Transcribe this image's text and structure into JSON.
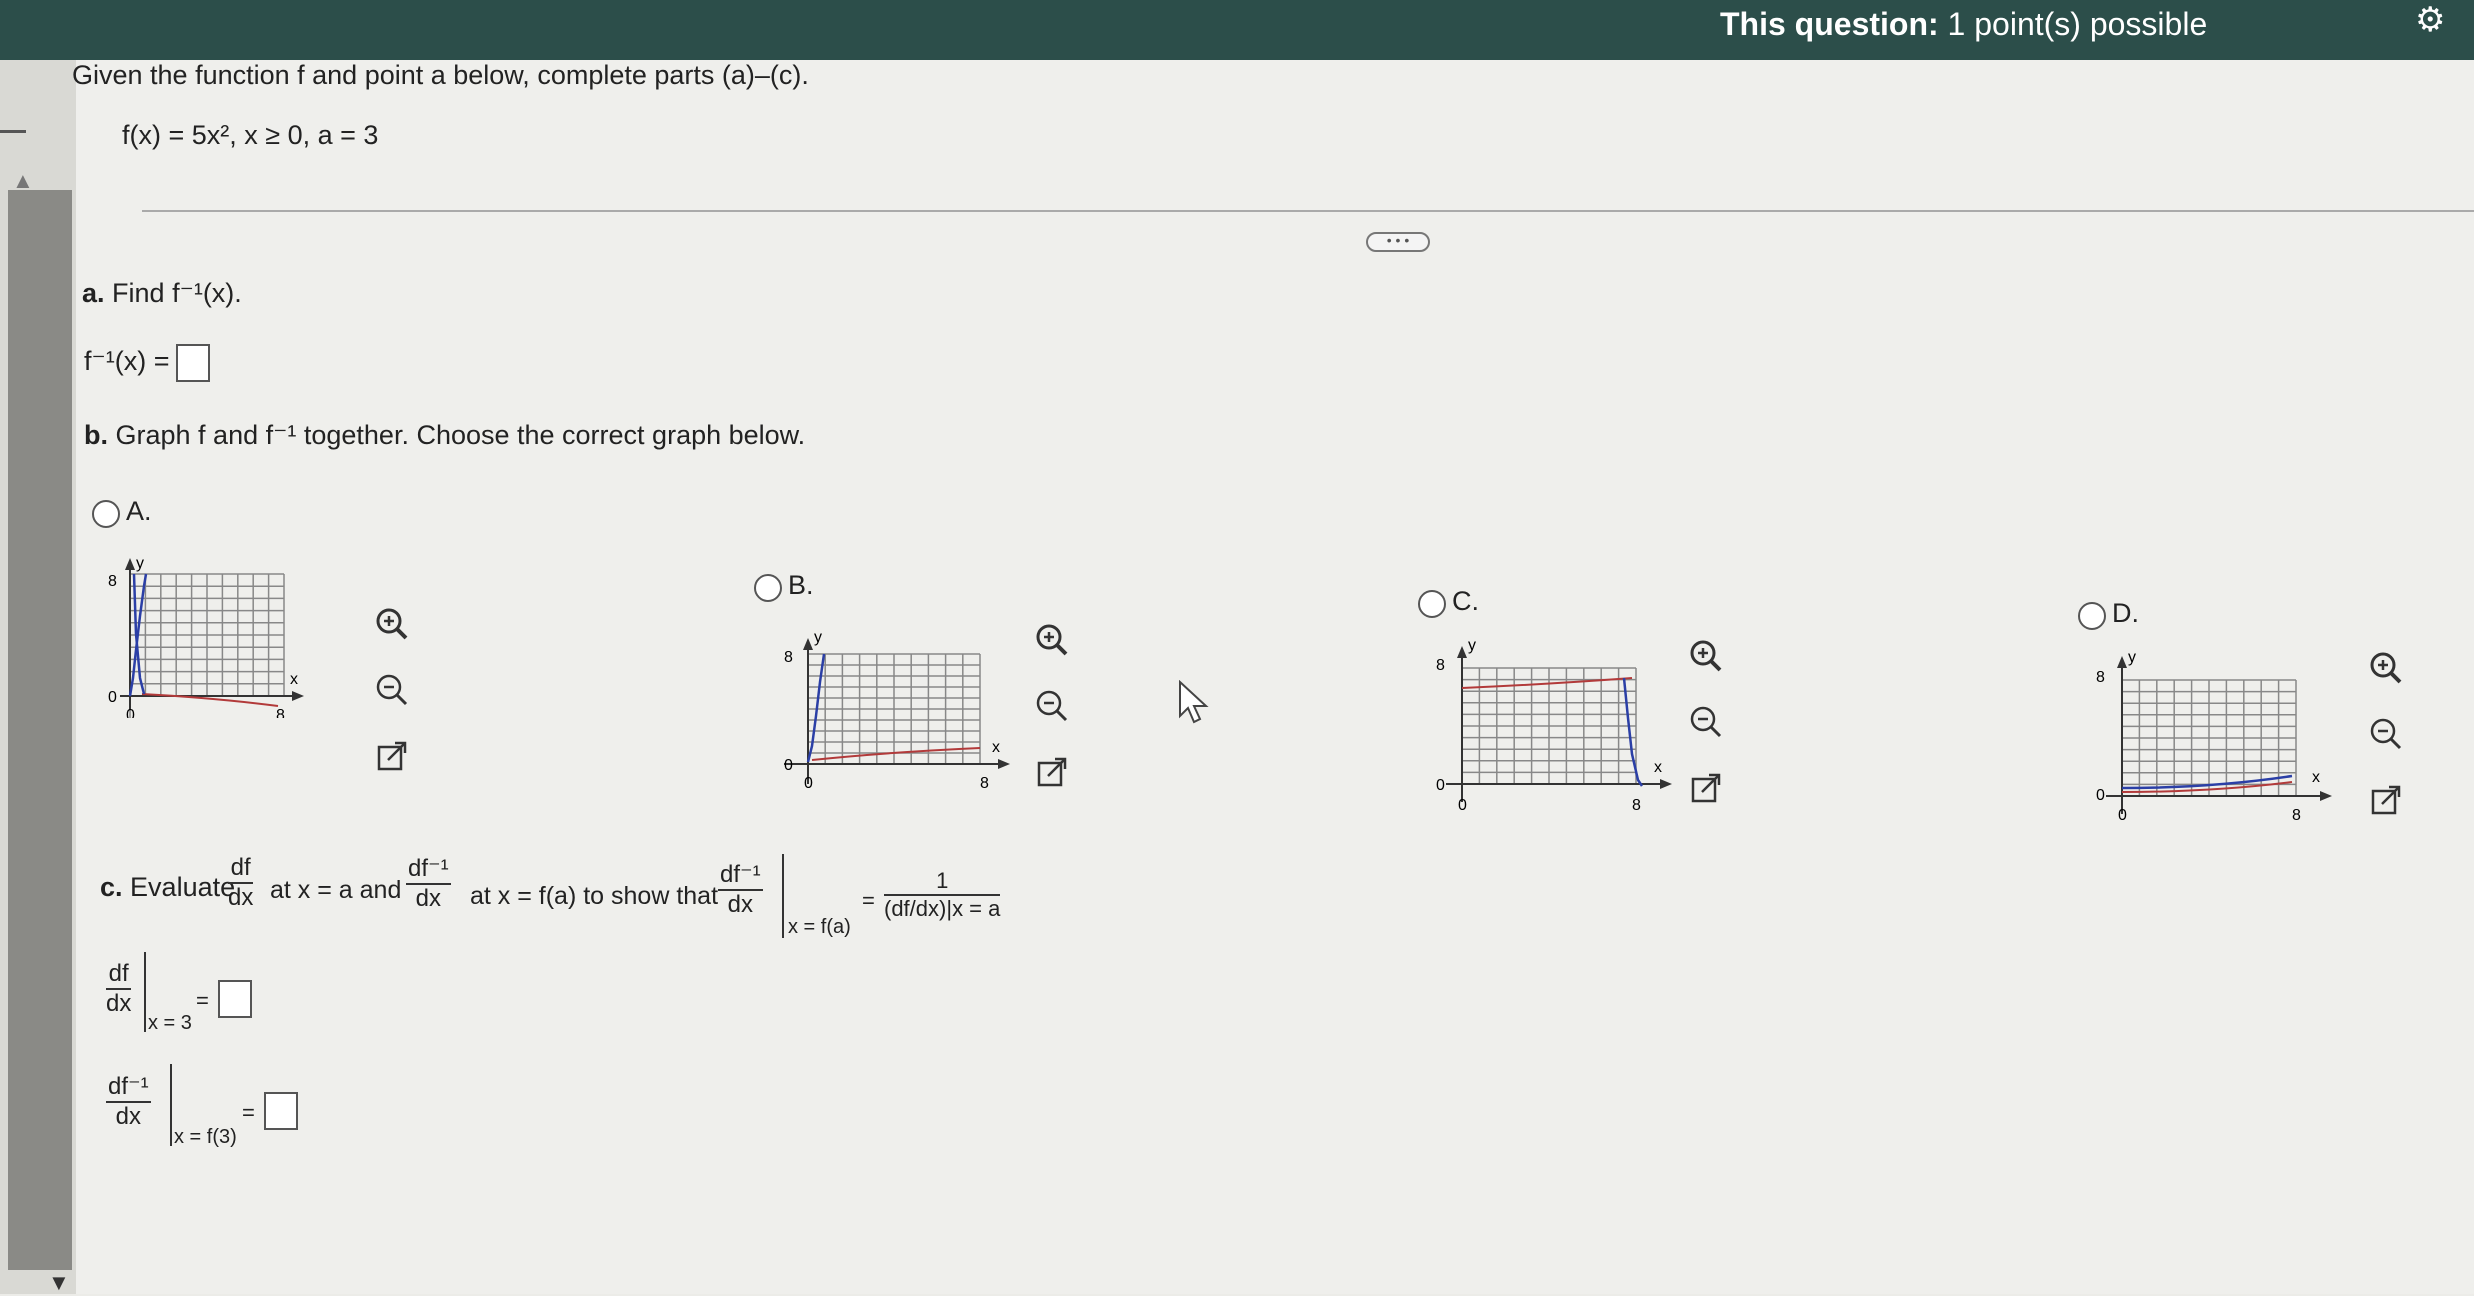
{
  "header": {
    "points_bold": "This question:",
    "points_rest": " 1 point(s) possible"
  },
  "problem": {
    "intro": "Given the function f and point a below, complete parts (a)–(c).",
    "function": "f(x) = 5x², x ≥ 0, a = 3"
  },
  "part_a": {
    "label": "a.",
    "prompt": "Find f⁻¹(x).",
    "answer_label": "f⁻¹(x) ="
  },
  "part_b": {
    "label": "b.",
    "prompt": "Graph f and f⁻¹ together. Choose the correct graph below.",
    "options": [
      {
        "letter": "A."
      },
      {
        "letter": "B."
      },
      {
        "letter": "C."
      },
      {
        "letter": "D."
      }
    ],
    "axis": {
      "y_label": "y",
      "x_label": "x",
      "ymax_tick": "8",
      "ymin_tick": "0",
      "xmin_tick": "0",
      "xmax_tick": "8"
    }
  },
  "part_c": {
    "label": "c.",
    "prompt_1": "Evaluate",
    "frac1_num": "df",
    "frac1_den": "dx",
    "prompt_2": "at x = a and",
    "frac2_num": "df⁻¹",
    "frac2_den": "dx",
    "prompt_3": "at x = f(a) to show that",
    "frac3_num": "df⁻¹",
    "frac3_den": "dx",
    "eval3": "x = f(a)",
    "eq": "=",
    "frac4_num": "1",
    "frac4_den": "(df/dx)|x = a",
    "row1_num": "df",
    "row1_den": "dx",
    "row1_eval": "x = 3",
    "row1_eq": "=",
    "row2_num": "df⁻¹",
    "row2_den": "dx",
    "row2_eval": "x = f(3)",
    "row2_eq": "="
  },
  "icons": [
    "zoom-in-icon",
    "zoom-out-icon",
    "open-external-icon",
    "gear-icon",
    "mouse-cursor-icon"
  ],
  "colors": {
    "topbar": "#2c4e4a",
    "curve_blue": "#2b3fa6",
    "curve_red": "#b23a3a",
    "grid": "#888888"
  }
}
